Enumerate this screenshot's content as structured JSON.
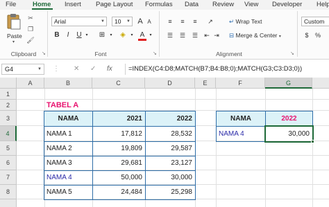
{
  "ribbon_tabs": [
    "File",
    "Home",
    "Insert",
    "Page Layout",
    "Formulas",
    "Data",
    "Review",
    "View",
    "Developer",
    "Help"
  ],
  "clipboard": {
    "paste_label": "Paste",
    "group_label": "Clipboard"
  },
  "font": {
    "name": "Arial",
    "size": "10",
    "group_label": "Font",
    "bold": "B",
    "italic": "I",
    "underline": "U",
    "grow": "A",
    "shrink": "A",
    "font_color": "A"
  },
  "alignment": {
    "wrap_label": "Wrap Text",
    "merge_label": "Merge & Center",
    "group_label": "Alignment"
  },
  "number": {
    "format_value": "Custom"
  },
  "formula_bar": {
    "name_box": "G4",
    "fx": "fx",
    "cancel": "✕",
    "enter": "✓",
    "formula": "=INDEX(C4:D8;MATCH(B7;B4:B8;0);MATCH(G3;C3:D3;0))"
  },
  "columns": [
    "A",
    "B",
    "C",
    "D",
    "E",
    "F",
    "G"
  ],
  "rows": [
    "1",
    "2",
    "3",
    "4",
    "5",
    "6",
    "7",
    "8"
  ],
  "sheet": {
    "title": "TABEL A",
    "headers": [
      "NAMA",
      "2021",
      "2022"
    ],
    "table": [
      [
        "NAMA 1",
        "17,812",
        "28,532"
      ],
      [
        "NAMA 2",
        "19,809",
        "29,587"
      ],
      [
        "NAMA 3",
        "29,681",
        "23,127"
      ],
      [
        "NAMA 4",
        "50,000",
        "30,000"
      ],
      [
        "NAMA 5",
        "24,484",
        "25,298"
      ]
    ],
    "lookup_headers": [
      "NAMA",
      "2022"
    ],
    "lookup_values": [
      "NAMA 4",
      "30,000"
    ]
  },
  "colors": {
    "accent_green": "#1e6a39",
    "title_pink": "#e8136f",
    "header_fill": "#dcf2f8",
    "table_border": "#2f6ea8",
    "highlight_blue": "#2b2ba8"
  }
}
